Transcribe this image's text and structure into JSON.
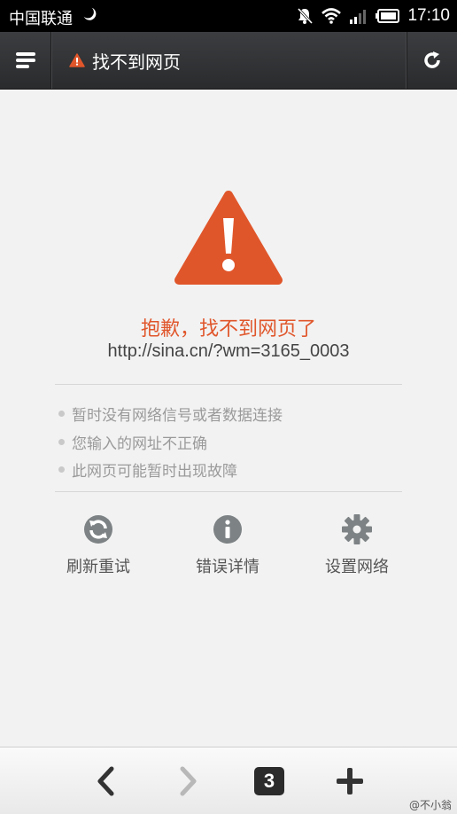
{
  "status_bar": {
    "carrier": "中国联通",
    "time": "17:10"
  },
  "toolbar": {
    "title": "找不到网页"
  },
  "error": {
    "heading": "抱歉，找不到网页了",
    "url": "http://sina.cn/?wm=3165_0003",
    "reasons": [
      "暂时没有网络信号或者数据连接",
      "您输入的网址不正确",
      "此网页可能暂时出现故障"
    ]
  },
  "actions": [
    {
      "label": "刷新重试",
      "icon": "refresh-icon"
    },
    {
      "label": "错误详情",
      "icon": "info-icon"
    },
    {
      "label": "设置网络",
      "icon": "gear-icon"
    }
  ],
  "bottom_bar": {
    "tab_count": "3"
  },
  "watermark": "@不小翁",
  "colors": {
    "accent": "#e0562b",
    "toolbar": "#333538",
    "background": "#f2f2f2"
  }
}
